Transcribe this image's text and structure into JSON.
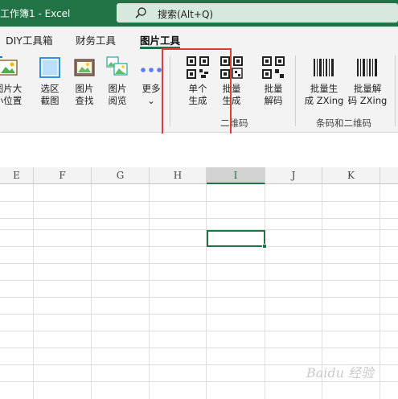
{
  "titlebar": {
    "title": "工作簿1  -  Excel",
    "search_placeholder": "搜索(Alt+Q)"
  },
  "tabs": [
    {
      "label": "DIY工具箱"
    },
    {
      "label": "财务工具"
    },
    {
      "label": "图片工具",
      "active": true
    }
  ],
  "ribbon": {
    "buttons": [
      {
        "label": "图片大\n小位置",
        "line1": "图片大",
        "line2": "小位置",
        "icon": "picture-resize-icon"
      },
      {
        "label": "选区截图",
        "line1": "选区",
        "line2": "截图",
        "icon": "screenshot-icon"
      },
      {
        "label": "图片查找",
        "line1": "图片",
        "line2": "查找",
        "icon": "picture-find-icon"
      },
      {
        "label": "图片阅览",
        "line1": "图片",
        "line2": "阅览",
        "icon": "picture-view-icon"
      },
      {
        "label": "更多",
        "line1": "更多",
        "line2": "⌄",
        "icon": "more-dots-icon"
      },
      {
        "label": "单个生成",
        "line1": "单个",
        "line2": "生成",
        "icon": "qrcode-icon"
      },
      {
        "label": "批量生成",
        "line1": "批量",
        "line2": "生成",
        "icon": "qrcode-batch-icon"
      },
      {
        "label": "批量解码",
        "line1": "批量",
        "line2": "解码",
        "icon": "qrcode-decode-icon"
      },
      {
        "label": "批量生成 ZXing",
        "line1": "批量生",
        "line2": "成 ZXing",
        "icon": "barcode-icon"
      },
      {
        "label": "批量解码 ZXing",
        "line1": "批量解",
        "line2": "码 ZXing",
        "icon": "barcode-decode-icon"
      }
    ],
    "groups": [
      {
        "label": "二维码"
      },
      {
        "label": "条码和二维码"
      }
    ]
  },
  "grid": {
    "columns": [
      "E",
      "F",
      "G",
      "H",
      "I",
      "J",
      "K"
    ],
    "selected_column": "I"
  },
  "watermark": "Baidu 经验",
  "colors": {
    "accent": "#217346",
    "highlight": "#e53935"
  }
}
